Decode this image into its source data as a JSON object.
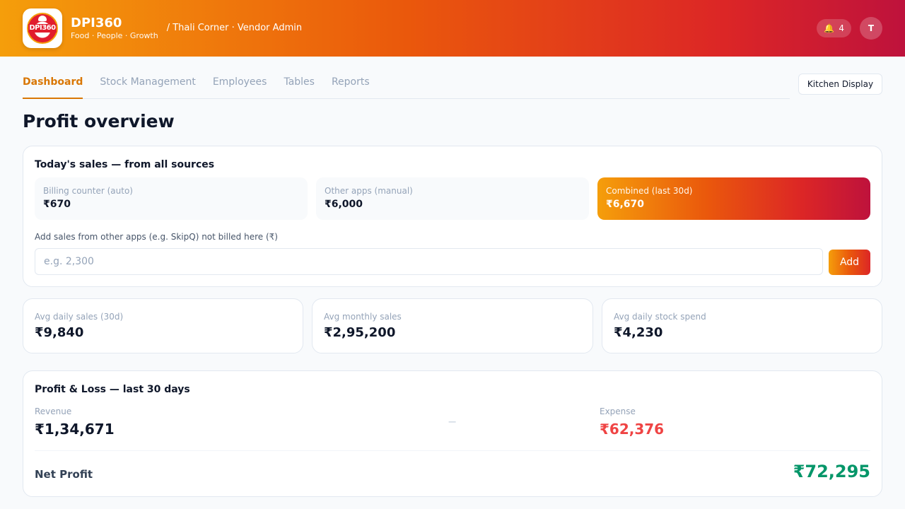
{
  "header": {
    "brand_name": "DPI360",
    "tagline": "Food · People · Growth",
    "logo_text": "DPI360",
    "breadcrumb": "/ Thali Corner · Vendor Admin",
    "notification_count": "4",
    "notification_icon": "bell-icon",
    "avatar_initial": "T"
  },
  "tabs": [
    {
      "label": "Dashboard",
      "active": true
    },
    {
      "label": "Stock Management",
      "active": false
    },
    {
      "label": "Employees",
      "active": false
    },
    {
      "label": "Tables",
      "active": false
    },
    {
      "label": "Reports",
      "active": false
    }
  ],
  "kitchen_display_label": "Kitchen Display",
  "page_title": "Profit overview",
  "sales": {
    "title": "Today's sales — from all sources",
    "boxes": [
      {
        "label": "Billing counter (auto)",
        "value": "₹670"
      },
      {
        "label": "Other apps (manual)",
        "value": "₹6,000"
      },
      {
        "label": "Combined (last 30d)",
        "value": "₹6,670"
      }
    ],
    "add_label": "Add sales from other apps (e.g. SkipQ) not billed here (₹)",
    "input_placeholder": "e.g. 2,300",
    "input_value": "",
    "add_button": "Add"
  },
  "stats": [
    {
      "label": "Avg daily sales (30d)",
      "value": "₹9,840"
    },
    {
      "label": "Avg monthly sales",
      "value": "₹2,95,200"
    },
    {
      "label": "Avg daily stock spend",
      "value": "₹4,230"
    }
  ],
  "pl": {
    "title": "Profit & Loss — last 30 days",
    "revenue_label": "Revenue",
    "revenue_value": "₹1,34,671",
    "operator": "−",
    "expense_label": "Expense",
    "expense_value": "₹62,376",
    "net_label": "Net Profit",
    "net_value": "₹72,295"
  },
  "colors": {
    "accent": "#d97706",
    "expense": "#ef4444",
    "profit": "#059669",
    "brand_gradient_start": "#f59e0b",
    "brand_gradient_end": "#be123c"
  }
}
